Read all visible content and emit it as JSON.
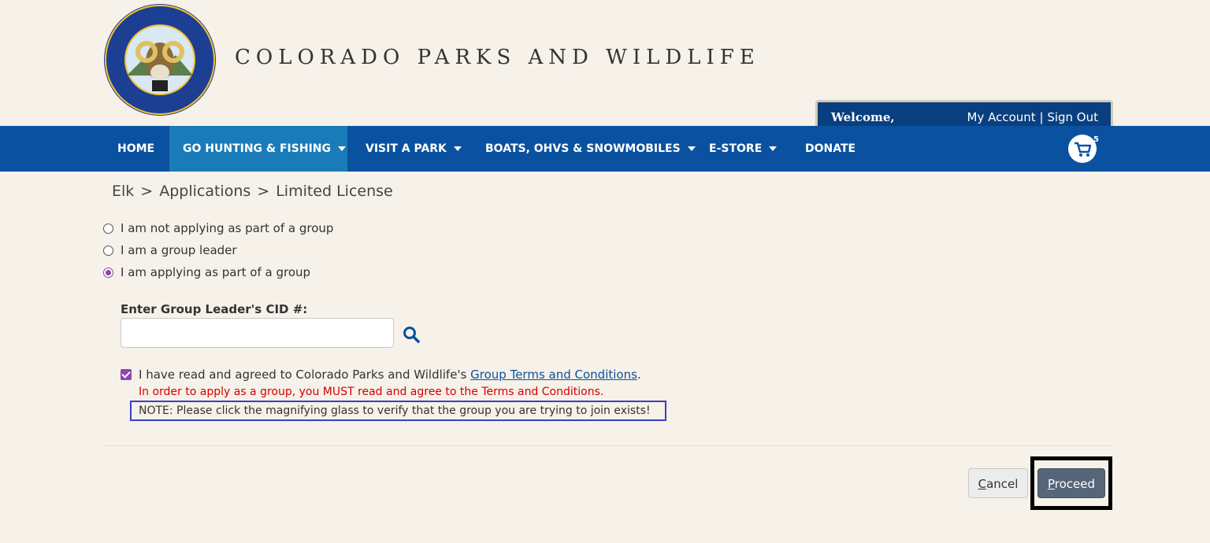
{
  "header": {
    "title": "COLORADO PARKS AND WILDLIFE",
    "logo_text": "COLORADO PARKS WILDLIFE",
    "welcome": "Welcome,",
    "my_account": "My Account",
    "separator": "|",
    "sign_out": "Sign Out"
  },
  "nav": {
    "items": [
      {
        "label": "HOME",
        "has_caret": false,
        "active": false
      },
      {
        "label": "GO HUNTING & FISHING",
        "has_caret": true,
        "active": true
      },
      {
        "label": "VISIT A PARK",
        "has_caret": true,
        "active": false
      },
      {
        "label": "BOATS, OHVS & SNOWMOBILES",
        "has_caret": true,
        "active": false
      },
      {
        "label": "E-STORE",
        "has_caret": true,
        "active": false
      },
      {
        "label": "DONATE",
        "has_caret": false,
        "active": false
      }
    ],
    "cart_count": "5"
  },
  "breadcrumb": {
    "items": [
      "Elk",
      "Applications",
      "Limited License"
    ],
    "separator": ">"
  },
  "group_options": [
    {
      "label": "I am not applying as part of a group",
      "checked": false
    },
    {
      "label": "I am a group leader",
      "checked": false
    },
    {
      "label": "I am applying as part of a group",
      "checked": true
    }
  ],
  "cid": {
    "label": "Enter Group Leader's CID #:",
    "value": ""
  },
  "agreement": {
    "text": "I have read and agreed to Colorado Parks and Wildlife's",
    "link": "Group Terms and Conditions",
    "suffix": ".",
    "checked": true,
    "warning": "In order to apply as a group, you MUST read and agree to the Terms and Conditions.",
    "note": "NOTE: Please click the magnifying glass to verify that the group you are trying to join exists!"
  },
  "actions": {
    "cancel_first": "C",
    "cancel_rest": "ancel",
    "proceed_first": "P",
    "proceed_rest": "roceed"
  },
  "colors": {
    "nav_bg": "#0a52a0",
    "nav_active": "#1a7bb9",
    "accent_purple": "#8e44ad",
    "warning_red": "#d40000",
    "note_border": "#3a3fc4",
    "page_bg": "#f6f1e9"
  }
}
